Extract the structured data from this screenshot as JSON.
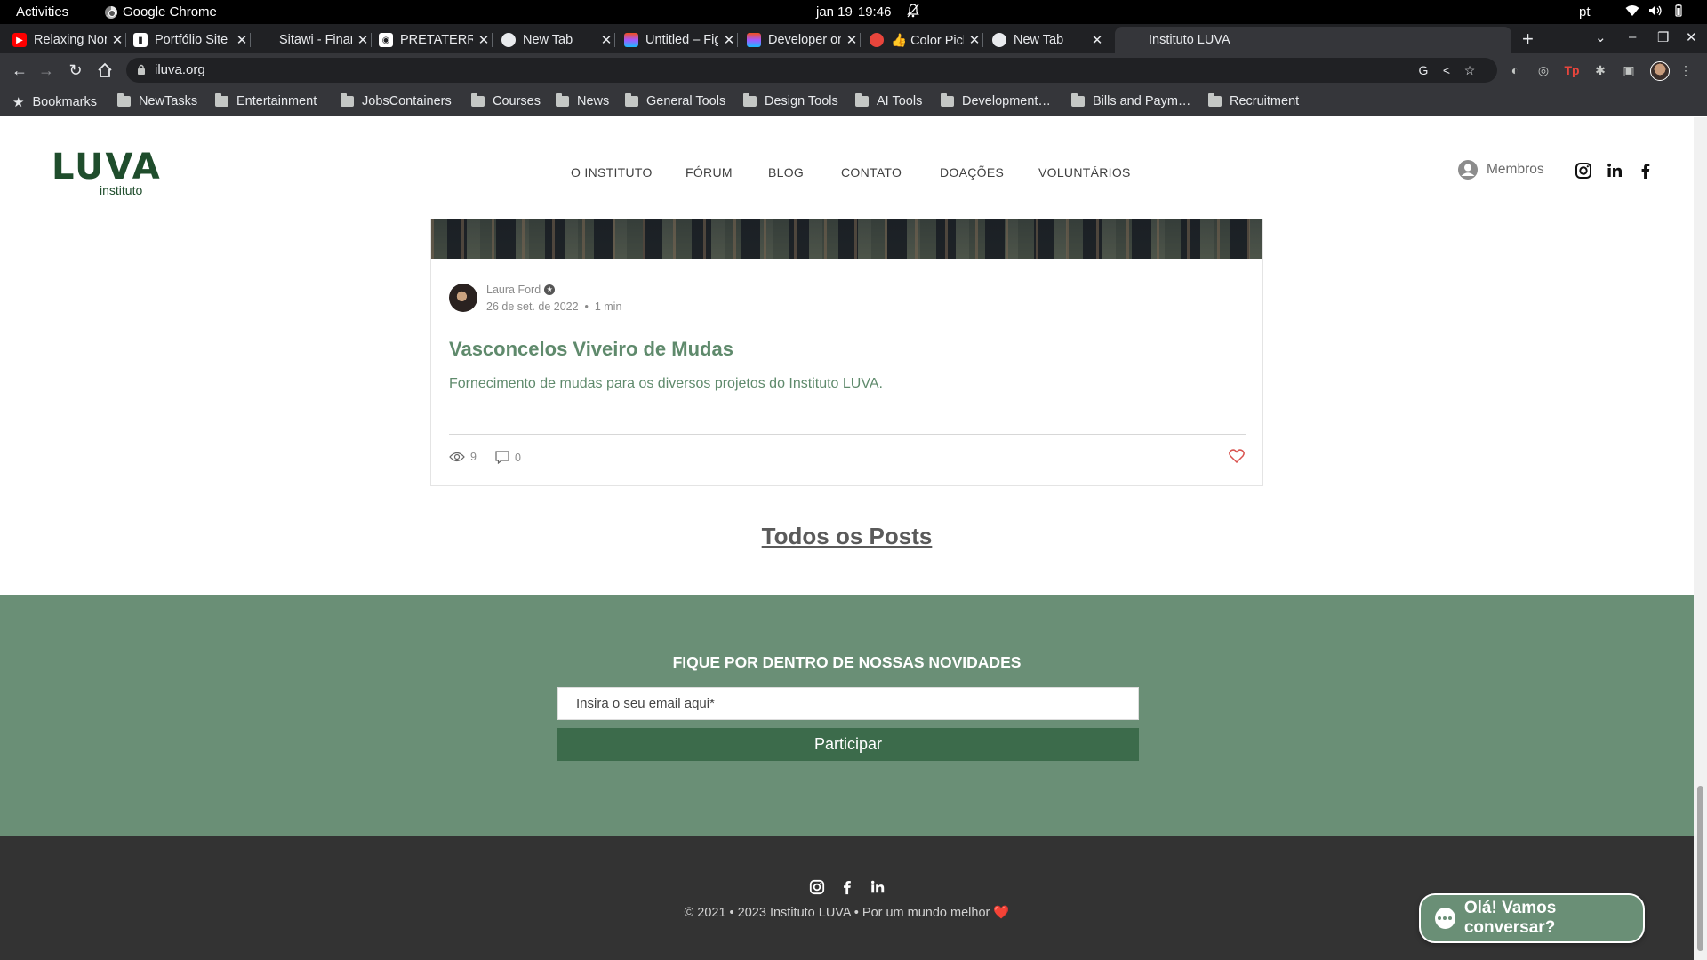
{
  "system_bar": {
    "activities": "Activities",
    "app_name": "Google Chrome",
    "date": "jan 19",
    "time": "19:46",
    "language": "pt"
  },
  "tabs": [
    {
      "title": "Relaxing Nordi",
      "favicon": "youtube-icon",
      "color": "#ff0000"
    },
    {
      "title": "Portfólio Site o",
      "favicon": "document-icon",
      "color": "#ffffff"
    },
    {
      "title": "Sitawi - Finança",
      "favicon": "none",
      "color": "#202124"
    },
    {
      "title": "PRETATERRA |",
      "favicon": "pretaterra-icon",
      "color": "#ffffff"
    },
    {
      "title": "New Tab",
      "favicon": "chrome-icon",
      "color": "#e8eaed"
    },
    {
      "title": "Untitled – Figm",
      "favicon": "figma-icon",
      "color": "#a259ff"
    },
    {
      "title": "Developer onb",
      "favicon": "figma-icon",
      "color": "#a259ff"
    },
    {
      "title": "👍 Color Picker",
      "favicon": "color-picker-icon",
      "color": "#e8453c"
    },
    {
      "title": "New Tab",
      "favicon": "chrome-icon",
      "color": "#e8eaed"
    },
    {
      "title": "Instituto LUVA",
      "favicon": "luva-icon",
      "color": "#35363a",
      "active": true
    }
  ],
  "toolbar": {
    "url": "iluva.org"
  },
  "bookmarks": {
    "main": "Bookmarks",
    "folders": [
      "NewTasks",
      "Entertainment",
      "JobsContainers",
      "Courses",
      "News",
      "General Tools",
      "Design Tools",
      "AI Tools",
      "Development…",
      "Bills and Paym…",
      "Recruitment"
    ]
  },
  "site": {
    "logo_main": "LUVA",
    "logo_sub": "instituto",
    "nav": [
      "O INSTITUTO",
      "FÓRUM",
      "BLOG",
      "CONTATO",
      "DOAÇÕES",
      "VOLUNTÁRIOS"
    ],
    "members_label": "Membros",
    "accent_color": "#6a8f76",
    "dark_green": "#3c6b4b"
  },
  "post": {
    "author": "Laura Ford",
    "date": "26 de set. de 2022",
    "read_time": "1 min",
    "title": "Vasconcelos Viveiro de Mudas",
    "excerpt": "Fornecimento de mudas para os diversos projetos do Instituto LUVA.",
    "views": "9",
    "comments": "0"
  },
  "all_posts_label": "Todos os Posts",
  "newsletter": {
    "title": "FIQUE POR DENTRO DE NOSSAS NOVIDADES",
    "email_placeholder": "Insira o seu email aqui*",
    "button": "Participar"
  },
  "footer": {
    "copyright": "© 2021 • 2023 Instituto LUVA • Por um mundo melhor ❤️"
  },
  "chat": {
    "label": "Olá! Vamos conversar?"
  }
}
